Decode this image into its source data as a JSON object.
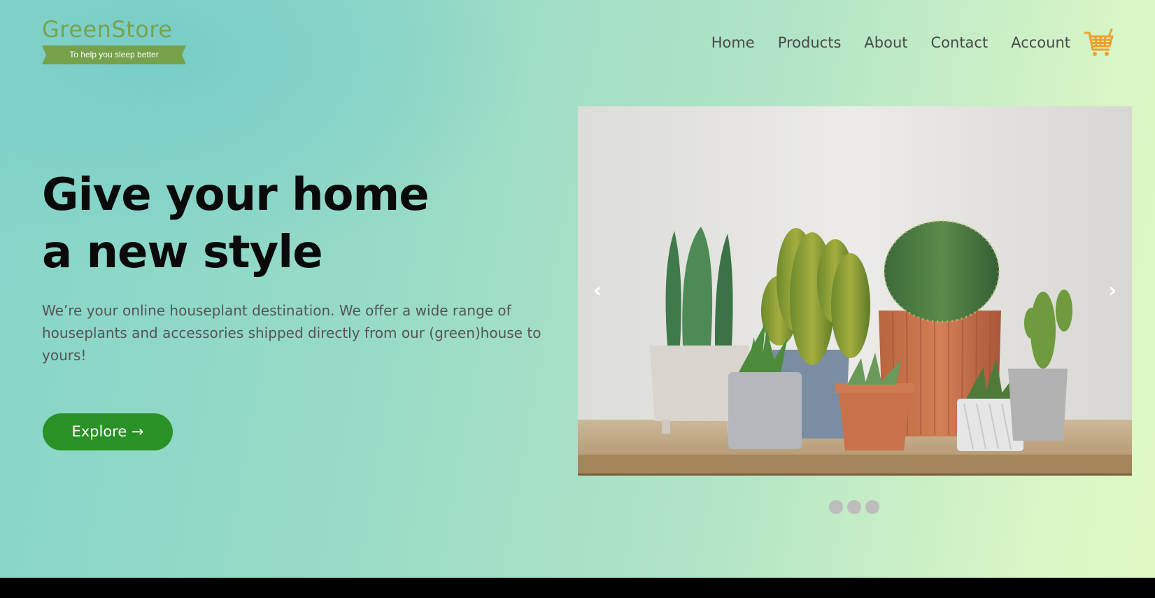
{
  "brand": {
    "name": "GreenStore",
    "tagline": "To help you sleep better",
    "color": "#78a24c"
  },
  "nav": {
    "items": [
      {
        "label": "Home"
      },
      {
        "label": "Products"
      },
      {
        "label": "About"
      },
      {
        "label": "Contact"
      },
      {
        "label": "Account"
      }
    ],
    "cart_icon": "shopping-cart-icon"
  },
  "hero": {
    "title_line1": "Give your home",
    "title_line2": "a new style",
    "description": "We’re your online houseplant destination. We offer a wide range of houseplants and accessories shipped directly from our (green)house to yours!",
    "button_label": "Explore →",
    "button_color": "#2a9127"
  },
  "carousel": {
    "prev_label": "‹",
    "next_label": "›",
    "slide_count": 3,
    "active_index": 0
  },
  "colors": {
    "accent": "#2a9127",
    "cart": "#f0a030",
    "text_dark": "#0a0a0a",
    "text_muted": "#555555"
  }
}
